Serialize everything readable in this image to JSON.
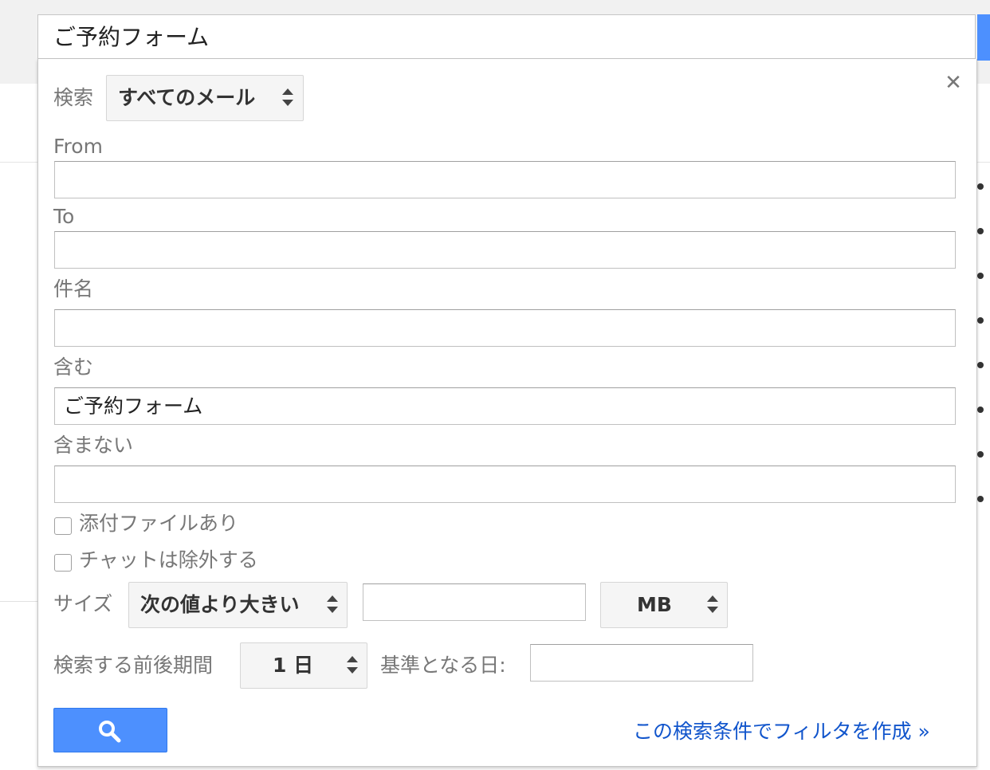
{
  "search": {
    "query": "ご予約フォーム"
  },
  "panel": {
    "search_in_label": "検索",
    "search_in_value": "すべてのメール",
    "from_label": "From",
    "from_value": "",
    "to_label": "To",
    "to_value": "",
    "subject_label": "件名",
    "subject_value": "",
    "has_words_label": "含む",
    "has_words_value": "ご予約フォーム",
    "not_words_label": "含まない",
    "not_words_value": "",
    "has_attachment_label": "添付ファイルあり",
    "has_attachment_checked": false,
    "exclude_chats_label": "チャットは除外する",
    "exclude_chats_checked": false,
    "size_label": "サイズ",
    "size_operator": "次の値より大きい",
    "size_value": "",
    "size_unit": "MB",
    "date_within_label": "検索する前後期間",
    "date_within_value": "1 日",
    "date_base_label": "基準となる日:",
    "date_base_value": "",
    "create_filter_link": "この検索条件でフィルタを作成 »"
  },
  "icons": {
    "close": "close-icon",
    "search": "search-icon",
    "select_arrows": "updown-arrows-icon"
  },
  "colors": {
    "search_button": "#4d90fe",
    "link": "#1155cc",
    "label": "#777777"
  }
}
